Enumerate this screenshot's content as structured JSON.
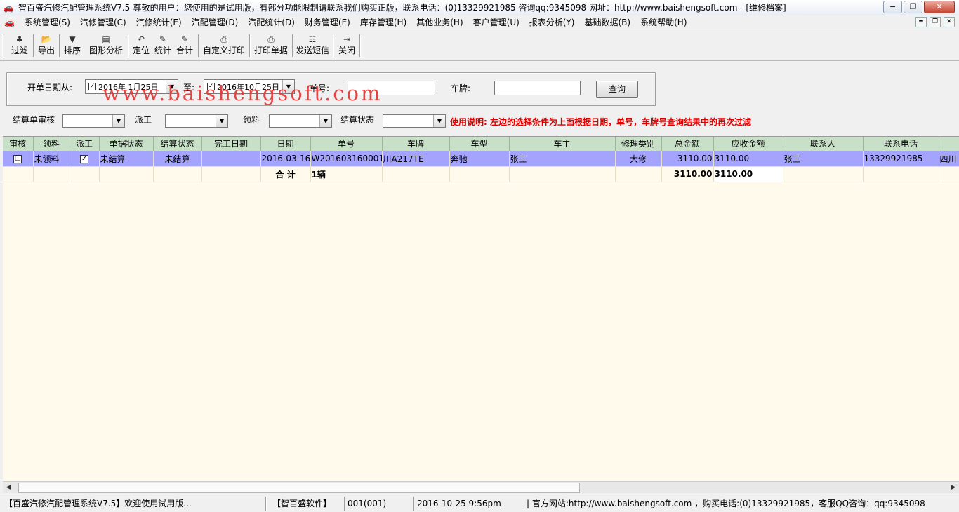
{
  "window": {
    "title": "智百盛汽修汽配管理系统V7.5-尊敬的用户：您使用的是试用版，有部分功能限制请联系我们购买正版，联系电话：(0)13329921985  咨询qq:9345098   网址：http://www.baishengsoft.com - [维修档案]",
    "min_label": "━",
    "max_label": "❐",
    "close_label": "✕"
  },
  "menu": [
    "系统管理(S)",
    "汽修管理(C)",
    "汽修统计(E)",
    "汽配管理(D)",
    "汽配统计(D)",
    "财务管理(E)",
    "库存管理(H)",
    "其他业务(H)",
    "客户管理(U)",
    "报表分析(Y)",
    "基础数据(B)",
    "系统帮助(H)"
  ],
  "toolbar": {
    "filter": "过滤",
    "export": "导出",
    "sort": "排序",
    "graph": "图形分析",
    "locate": "定位",
    "stats": "统计",
    "total": "合计",
    "custom_print": "自定义打印",
    "print_doc": "打印单据",
    "send_sms": "发送短信",
    "close": "关闭"
  },
  "filters": {
    "date_from_label": "开单日期从:",
    "date_from": "2016年  1月25日",
    "to_label": "至:",
    "date_to": "2016年10月25日",
    "order_no_label": "单号:",
    "order_no": "",
    "plate_label": "车牌:",
    "plate": "",
    "query_button": "查询",
    "settle_review_label": "结算单审核",
    "dispatch_label": "派工",
    "material_label": "领料",
    "settle_status_label": "结算状态"
  },
  "note": "使用说明:   左边的选择条件为上面根据日期，单号，车牌号查询结果中的再次过滤",
  "watermark": "www.baishengsoft.com",
  "table": {
    "columns": [
      "审核",
      "领料",
      "派工",
      "单据状态",
      "结算状态",
      "完工日期",
      "日期",
      "单号",
      "车牌",
      "车型",
      "车主",
      "修理类别",
      "总金额",
      "应收金额",
      "联系人",
      "联系电话",
      ""
    ],
    "rows": [
      {
        "review": "☐",
        "material": "未领料",
        "dispatch": "✓",
        "doc_status": "未结算",
        "settle_status": "未结算",
        "finish_date": "",
        "date": "2016-03-16",
        "order_no": "W201603160001",
        "plate": "川A217TE",
        "model": "奔驰",
        "owner": "张三",
        "repair_type": "大修",
        "total": "3110.00",
        "receivable": "3110.00",
        "contact": "张三",
        "phone": "13329921985",
        "extra": "四川"
      }
    ],
    "total_row": {
      "label": "合 计",
      "count": "1辆",
      "total": "3110.00",
      "receivable": "3110.00"
    }
  },
  "status": {
    "app": "【百盛汽修汽配管理系统V7.5】欢迎使用试用版...",
    "company": "【智百盛软件】",
    "user": "001(001)",
    "datetime": "2016-10-25  9:56pm",
    "website": "|  官方网站:http://www.baishengsoft.com ，购买电话:(0)13329921985，客服QQ咨询：qq:9345098"
  }
}
